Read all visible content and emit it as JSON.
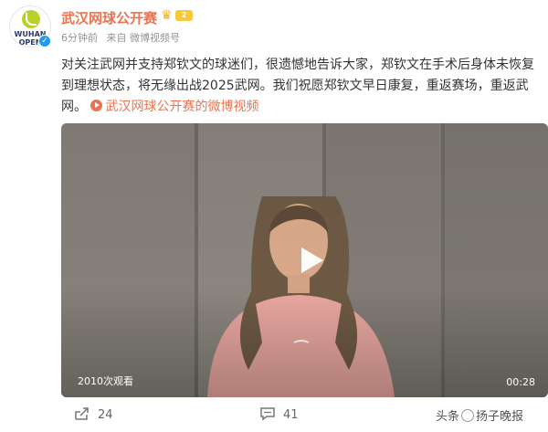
{
  "account": {
    "name": "武汉网球公开赛",
    "avatar_text_1": "WUHAN",
    "avatar_text_2": "OPEN",
    "member_badge": "2"
  },
  "meta": {
    "time": "6分钟前",
    "source": "来自 微博视频号"
  },
  "post": {
    "text": "对关注武网并支持郑钦文的球迷们，很遗憾地告诉大家，郑钦文在手术后身体未恢复到理想状态，将无缘出战2025武网。我们祝愿郑钦文早日康复，重返赛场，重返武网。",
    "link_label": "武汉网球公开赛的微博视频"
  },
  "video": {
    "views": "2010次观看",
    "duration": "00:28"
  },
  "actions": {
    "share_count": "24",
    "comment_count": "41"
  },
  "watermark": {
    "prefix": "头条",
    "name": "扬子晚报"
  },
  "colors": {
    "accent": "#eb7350",
    "verified": "#1e9bf0",
    "crown": "#f2b01e"
  },
  "icons": [
    "verified-icon",
    "crown-icon",
    "link-play-icon",
    "play-icon",
    "share-icon",
    "comment-icon"
  ]
}
